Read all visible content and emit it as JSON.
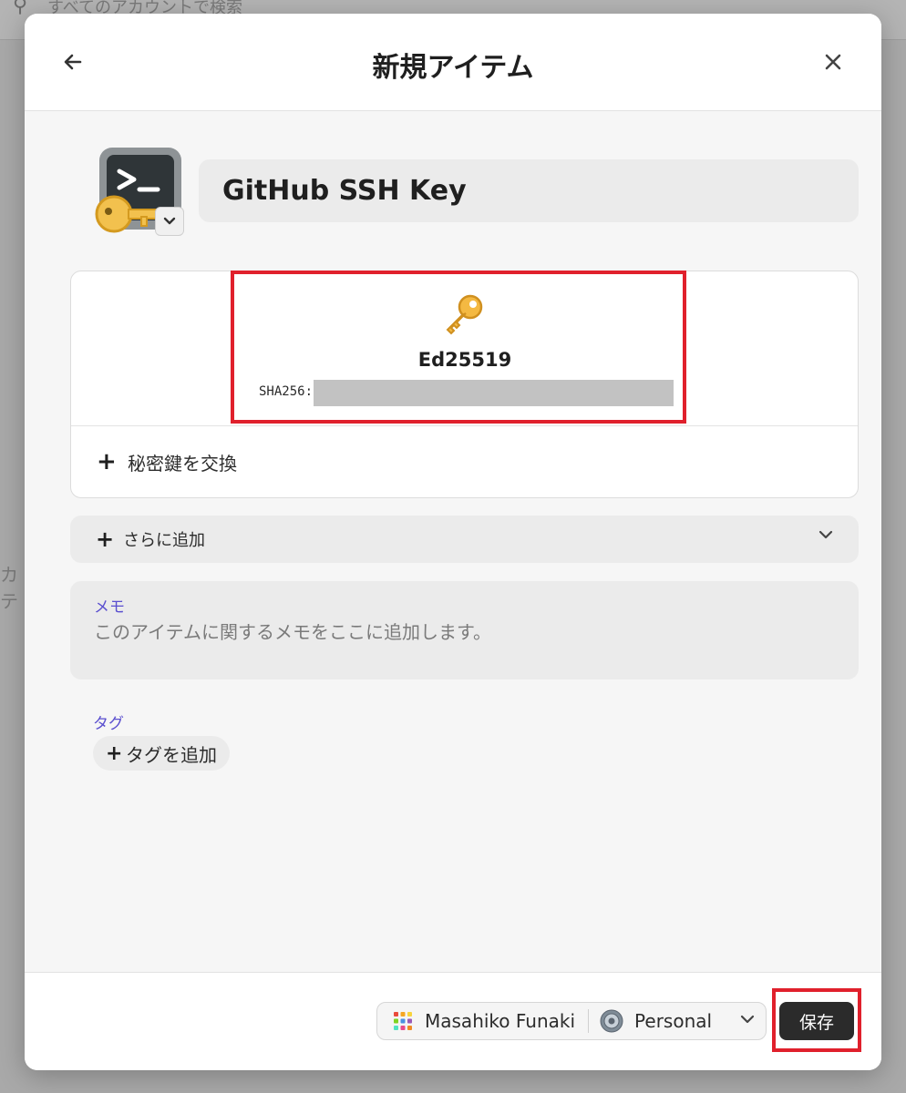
{
  "background": {
    "search_placeholder": "すべてのアカウントで検索",
    "side_text": "カテ"
  },
  "modal": {
    "title": "新規アイテム"
  },
  "item": {
    "title": "GitHub SSH Key",
    "icon": "terminal-key-icon"
  },
  "key": {
    "type": "Ed25519",
    "fingerprint_label": "SHA256:",
    "replace_label": "秘密鍵を交換"
  },
  "add_more": {
    "label": "さらに追加"
  },
  "notes": {
    "label": "メモ",
    "placeholder": "このアイテムに関するメモをここに追加します。"
  },
  "tags": {
    "label": "タグ",
    "add_label": "タグを追加"
  },
  "footer": {
    "account": "Masahiko Funaki",
    "vault": "Personal",
    "save_label": "保存"
  },
  "colors": {
    "accent_label": "#5a4fcf",
    "highlight": "#e0202c",
    "save_button": "#2b2b2b"
  }
}
